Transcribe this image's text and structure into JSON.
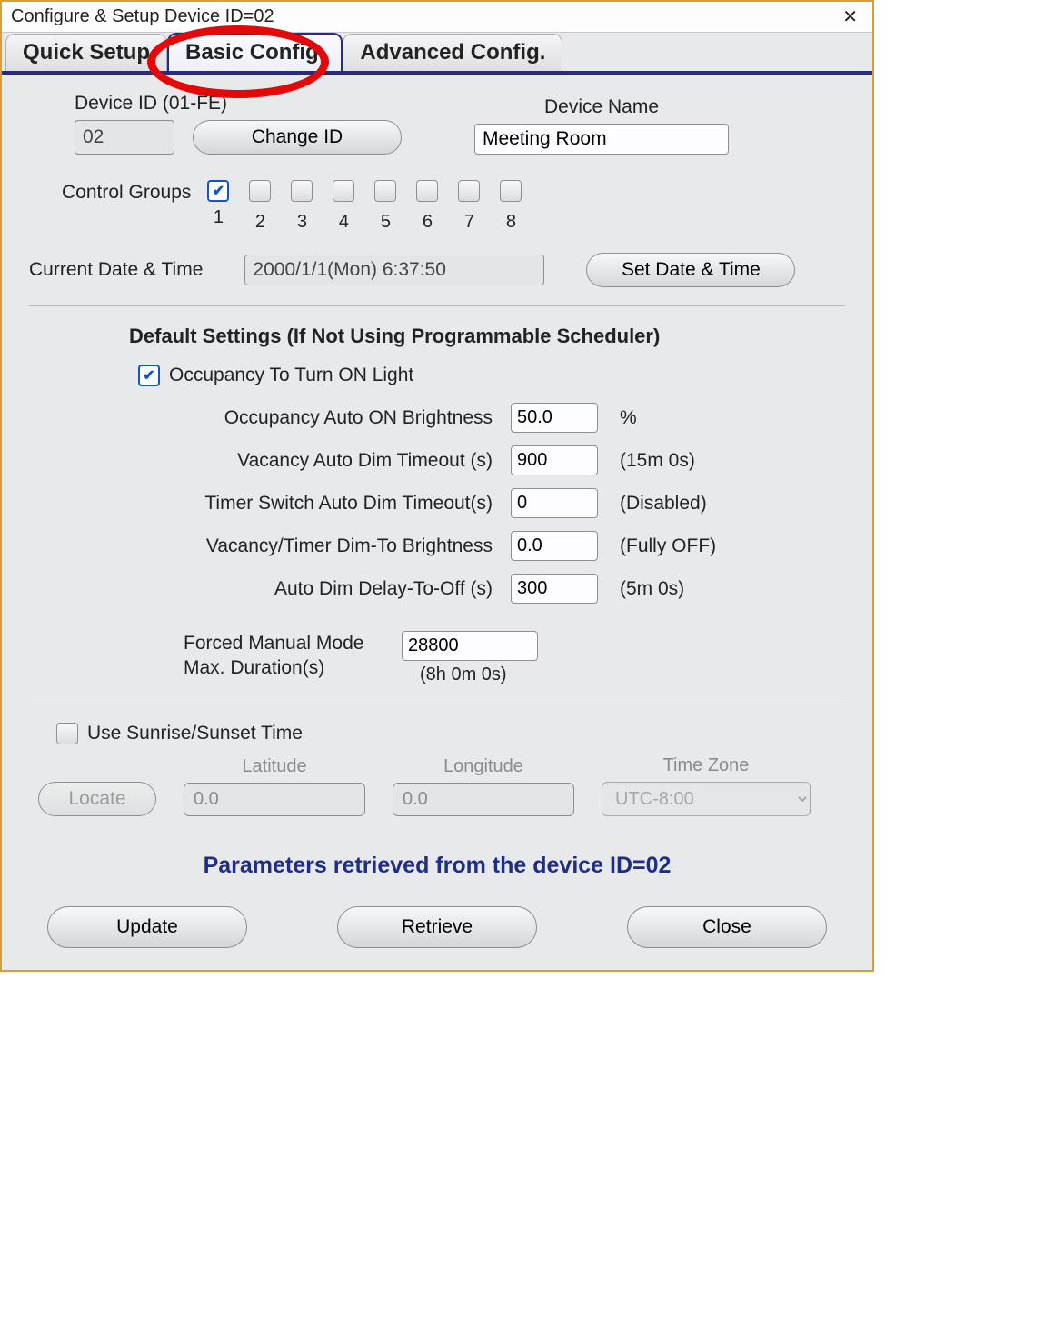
{
  "window": {
    "title": "Configure & Setup Device ID=02"
  },
  "tabs": {
    "quick": "Quick Setup",
    "basic": "Basic Config.",
    "advanced": "Advanced Config."
  },
  "device": {
    "id_label": "Device ID (01-FE)",
    "id_value": "02",
    "change_id_btn": "Change ID",
    "name_label": "Device Name",
    "name_value": "Meeting Room"
  },
  "control_groups": {
    "label": "Control Groups",
    "items": [
      {
        "num": "1",
        "checked": true
      },
      {
        "num": "2",
        "checked": false
      },
      {
        "num": "3",
        "checked": false
      },
      {
        "num": "4",
        "checked": false
      },
      {
        "num": "5",
        "checked": false
      },
      {
        "num": "6",
        "checked": false
      },
      {
        "num": "7",
        "checked": false
      },
      {
        "num": "8",
        "checked": false
      }
    ]
  },
  "datetime": {
    "label": "Current Date & Time",
    "value": "2000/1/1(Mon) 6:37:50",
    "set_btn": "Set Date & Time"
  },
  "defaults": {
    "title": "Default Settings (If Not Using Programmable Scheduler)",
    "occ_on_label": "Occupancy To Turn ON Light",
    "occ_on_checked": true,
    "rows": [
      {
        "label": "Occupancy Auto ON  Brightness",
        "value": "50.0",
        "suffix": "%"
      },
      {
        "label": "Vacancy Auto Dim Timeout (s)",
        "value": "900",
        "suffix": "(15m 0s)"
      },
      {
        "label": "Timer Switch Auto Dim Timeout(s)",
        "value": "0",
        "suffix": "(Disabled)"
      },
      {
        "label": "Vacancy/Timer Dim-To Brightness",
        "value": "0.0",
        "suffix": "(Fully OFF)"
      },
      {
        "label": "Auto Dim Delay-To-Off (s)",
        "value": "300",
        "suffix": "(5m 0s)"
      }
    ],
    "forced": {
      "label1": "Forced Manual Mode",
      "label2": "Max. Duration(s)",
      "value": "28800",
      "hint": "(8h 0m 0s)"
    }
  },
  "sun": {
    "use_label": "Use Sunrise/Sunset Time",
    "use_checked": false,
    "locate_btn": "Locate",
    "lat_label": "Latitude",
    "lat_value": "0.0",
    "lon_label": "Longitude",
    "lon_value": "0.0",
    "tz_label": "Time Zone",
    "tz_value": "UTC-8:00"
  },
  "status": "Parameters retrieved from the device ID=02",
  "footer": {
    "update": "Update",
    "retrieve": "Retrieve",
    "close": "Close"
  }
}
